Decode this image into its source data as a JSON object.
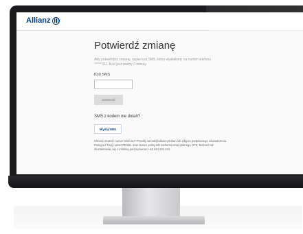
{
  "brand": {
    "name": "Allianz"
  },
  "page": {
    "title": "Potwierdź zmianę",
    "description": "Aby potwierdzić zmianę, wpisz kod SMS, który wysłaliśmy na numer telefonu ******111. Kod jest ważny 3 minuty.",
    "sms_label": "Kod SMS",
    "sms_value": "",
    "confirm_label": "Zatwierdź",
    "no_sms_text": "SMS z kodem nie dotarł?",
    "send_label": "Wyślij SMS",
    "info_text": "Chcesz zmienić numer telefonu? Prześlij na bok@allianz.pl skan lub zdjęcie podpisanego oświadczenia. Podaj też Twój numer PESEL oraz numer polisy lub rachunku emerytalnego OFE. Możesz też skontaktować się z infolinią pod numerem +48 224 224 224."
  }
}
